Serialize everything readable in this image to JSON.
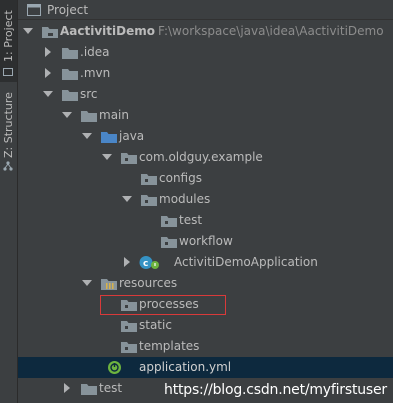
{
  "side": {
    "project_tab": "1: Project",
    "structure_tab": "Z: Structure"
  },
  "panel": {
    "title": "Project",
    "icon": "project-window-icon"
  },
  "tree": {
    "root": {
      "label": "AactivitiDemo",
      "path": "F:\\workspace\\java\\idea\\AactivitiDemo"
    },
    "idea": ".idea",
    "mvn": ".mvn",
    "src": "src",
    "main": "main",
    "java": "java",
    "package": "com.oldguy.example",
    "configs": "configs",
    "modules": "modules",
    "test_pkg": "test",
    "workflow": "workflow",
    "app_class": "ActivitiDemoApplication",
    "resources": "resources",
    "processes": "processes",
    "static": "static",
    "templates": "templates",
    "app_yml": "application.yml",
    "test_dir": "test"
  },
  "colors": {
    "background": "#3c3f41",
    "selection": "#0d293e",
    "highlight_border": "#d93a3a",
    "folder": "#87939a",
    "source_folder": "#4a86c7",
    "spring_green": "#6db33f"
  },
  "watermark": "https://blog.csdn.net/myfirstuser"
}
